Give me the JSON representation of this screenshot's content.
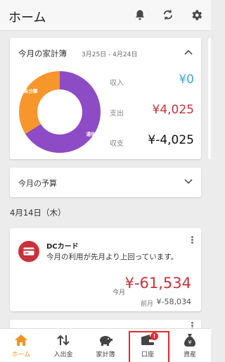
{
  "appbar": {
    "title": "ホーム",
    "icons": [
      "bell-icon",
      "sync-icon",
      "gear-icon"
    ]
  },
  "summary": {
    "title": "今月の家計簿",
    "range": "3月25日 - 4月24日",
    "chart_labels": {
      "unassigned": "未分類",
      "telecom": "通信費"
    },
    "income_label": "収入",
    "income_value": "¥0",
    "expense_label": "支出",
    "expense_value": "¥4,025",
    "balance_label": "収支",
    "balance_value": "¥-4,025",
    "colors": {
      "income": "#3aa9d6",
      "expense": "#c9323c",
      "unassigned": "#f7962b",
      "telecom": "#8e4bc6"
    }
  },
  "chart_data": {
    "type": "pie",
    "categories": [
      "未分類",
      "通信費"
    ],
    "values": [
      34,
      66
    ],
    "title": ""
  },
  "budget": {
    "title": "今月の予算"
  },
  "date_header": "4月14日（木）",
  "notification": {
    "account": "DCカード",
    "message": "今月の利用が先月より上回っています。",
    "current_label": "今月",
    "current_value": "¥-61,534",
    "previous_label": "前月",
    "previous_value": "¥-58,034"
  },
  "tabs": [
    {
      "label": "ホーム",
      "icon": "home-icon",
      "active": true
    },
    {
      "label": "入出金",
      "icon": "transfer-arrows-icon"
    },
    {
      "label": "家計簿",
      "icon": "piggy-bank-icon"
    },
    {
      "label": "口座",
      "icon": "wallet-icon",
      "badge": "!"
    },
    {
      "label": "資産",
      "icon": "money-bag-icon"
    }
  ]
}
